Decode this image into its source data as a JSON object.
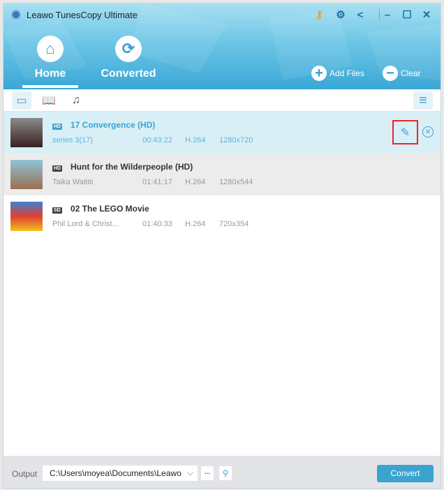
{
  "app": {
    "title": "Leawo TunesCopy Ultimate"
  },
  "nav": {
    "home": "Home",
    "converted": "Converted",
    "add_files": "Add Files",
    "clear": "Clear"
  },
  "rows": [
    {
      "badge": "HD",
      "title": "17 Convergence (HD)",
      "artist": "series 3(17)",
      "duration": "00:43:22",
      "codec": "H.264",
      "resolution": "1280x720"
    },
    {
      "badge": "HD",
      "title": "Hunt for the Wilderpeople (HD)",
      "artist": "Taika Waititi",
      "duration": "01:41:17",
      "codec": "H.264",
      "resolution": "1280x544"
    },
    {
      "badge": "SD",
      "title": "02 The LEGO Movie",
      "artist": "Phil Lord & Christ...",
      "duration": "01:40:33",
      "codec": "H.264",
      "resolution": "720x354"
    }
  ],
  "footer": {
    "output_label": "Output",
    "output_path": "C:\\Users\\moyea\\Documents\\Leawo",
    "browse": "...",
    "convert": "Convert"
  },
  "colors": {
    "accent": "#3aa3d4",
    "selected_row": "#d9eff6",
    "hover_row": "#ececec",
    "highlight": "#e8262a"
  }
}
